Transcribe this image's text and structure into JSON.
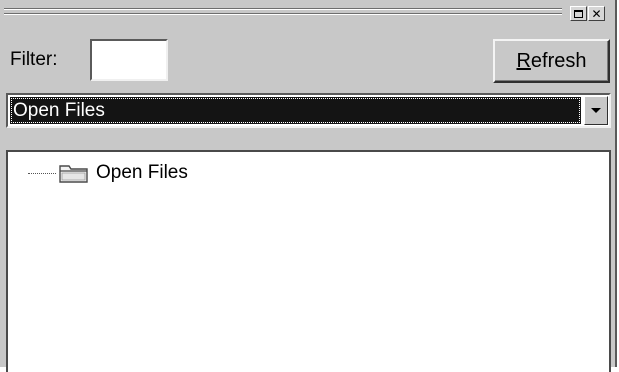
{
  "window": {
    "controls": [
      "maximize-icon",
      "close-icon"
    ]
  },
  "filter": {
    "label": "Filter:",
    "value": ""
  },
  "refresh_button": {
    "mnemonic": "R",
    "rest": "efresh"
  },
  "dropdown": {
    "selected": "Open Files"
  },
  "tree": {
    "nodes": [
      {
        "label": "Open Files",
        "icon": "folder-icon"
      }
    ]
  }
}
